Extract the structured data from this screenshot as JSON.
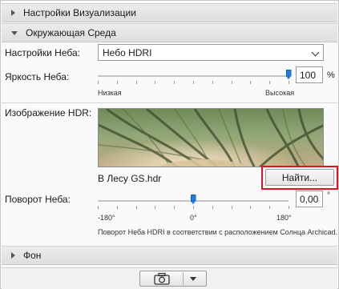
{
  "sections": {
    "visualization": {
      "title": "Настройки Визуализации",
      "expanded": false
    },
    "environment": {
      "title": "Окружающая Среда",
      "expanded": true
    },
    "background": {
      "title": "Фон",
      "expanded": false
    }
  },
  "sky_settings": {
    "label": "Настройки Неба:",
    "selected": "Небо HDRI"
  },
  "sky_brightness": {
    "label": "Яркость Неба:",
    "value": "100",
    "unit": "%",
    "min_label": "Низкая",
    "max_label": "Высокая",
    "level": 1.0
  },
  "hdr_image": {
    "label": "Изображение HDR:",
    "file_name": "В Лесу GS.hdr",
    "find_button": "Найти..."
  },
  "sky_rotation": {
    "label": "Поворот Неба:",
    "value": "0,00",
    "unit": "°",
    "tick_min": "-180°",
    "tick_mid": "0°",
    "tick_max": "180°",
    "description": "Поворот Неба HDRI в соответствии с расположением Солнца Archicad.",
    "level": 0.5
  },
  "footer": {
    "camera_icon": "camera-icon",
    "dropdown_icon": "triangle-down-icon"
  },
  "colors": {
    "accent": "#1f7be0",
    "highlight": "#e0141e"
  }
}
